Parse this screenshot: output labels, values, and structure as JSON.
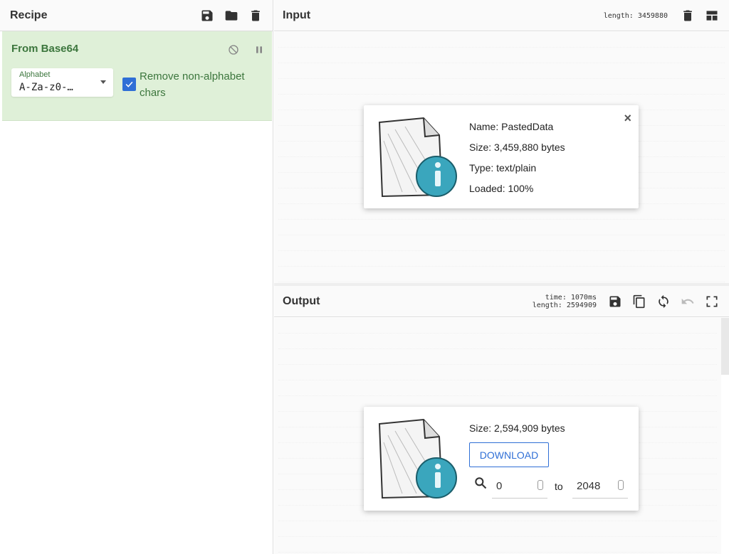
{
  "recipe": {
    "title": "Recipe",
    "operation": {
      "name": "From Base64",
      "alphabet_label": "Alphabet",
      "alphabet_value": "A-Za-z0-…",
      "remove_label": "Remove non-alphabet chars"
    }
  },
  "input": {
    "title": "Input",
    "length": "length: 3459880",
    "file_info": {
      "name": "Name: PastedData",
      "size": "Size: 3,459,880 bytes",
      "type": "Type: text/plain",
      "loaded": "Loaded: 100%",
      "close": "×"
    }
  },
  "output": {
    "title": "Output",
    "time": "time:  1070ms",
    "length": "length: 2594909",
    "file_info": {
      "size": "Size: 2,594,909 bytes",
      "download_label": "DOWNLOAD",
      "from_value": "0",
      "to_label": "to",
      "to_value": "2048"
    }
  },
  "icons": {
    "accent": "#2f6fd6",
    "op_green": "#3c763d",
    "op_bg": "#dff0d8"
  }
}
